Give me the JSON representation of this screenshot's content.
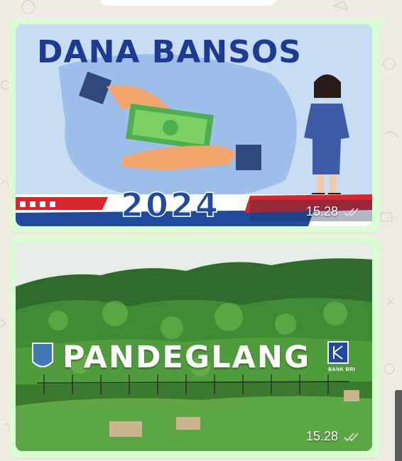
{
  "chat": {
    "background_color": "#efeae2",
    "bubble_color": "#d9fdd3",
    "messages": [
      {
        "type": "image",
        "image_title": "DANA BANSOS",
        "image_year": "2024",
        "time": "15.28",
        "status_icon": "double-check-icon"
      },
      {
        "type": "image",
        "image_sign": "PANDEGLANG",
        "image_logo_text": "BANK BRI",
        "time": "15.28",
        "status_icon": "double-check-icon"
      }
    ]
  }
}
